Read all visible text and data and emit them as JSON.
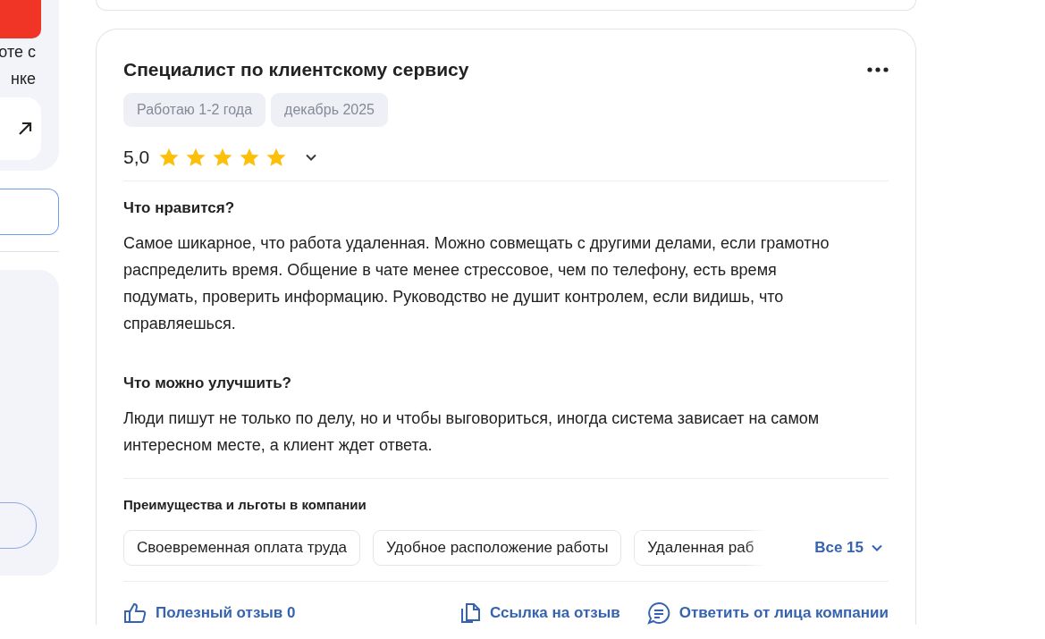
{
  "sidebar": {
    "promo_text": [
      "оте с",
      "нке"
    ]
  },
  "review": {
    "title": "Специалист по клиентскому сервису",
    "tags": [
      "Работаю 1-2 года",
      "декабрь 2025"
    ],
    "rating": "5,0",
    "stars": 5,
    "expanded": false,
    "sections": [
      {
        "heading": "Что нравится?",
        "text": "Самое шикарное, что работа удаленная. Можно совмещать с другими делами, если грамотно распределить время. Общение в чате менее стрессовое, чем по телефону, есть время подумать, проверить информацию. Руководство не душит контролем, если видишь, что справляешься."
      },
      {
        "heading": "Что можно улучшить?",
        "text": "Люди пишут не только по делу, но и чтобы выговориться, иногда система зависает на самом интересном месте, а клиент ждет ответа."
      }
    ],
    "benefits": {
      "heading": "Преимущества и льготы в компании",
      "items": [
        {
          "label": "Своевременная оплата труда",
          "cut": false
        },
        {
          "label": "Удобное расположение работы",
          "cut": false
        },
        {
          "label": "Удаленная раб",
          "cut": true
        }
      ],
      "all": "Все 15"
    },
    "actions": [
      {
        "kind": "like",
        "label": "Полезный отзыв 0"
      },
      {
        "kind": "link",
        "label": "Ссылка на отзыв"
      },
      {
        "kind": "reply",
        "label": "Ответить от лица компании"
      }
    ]
  }
}
